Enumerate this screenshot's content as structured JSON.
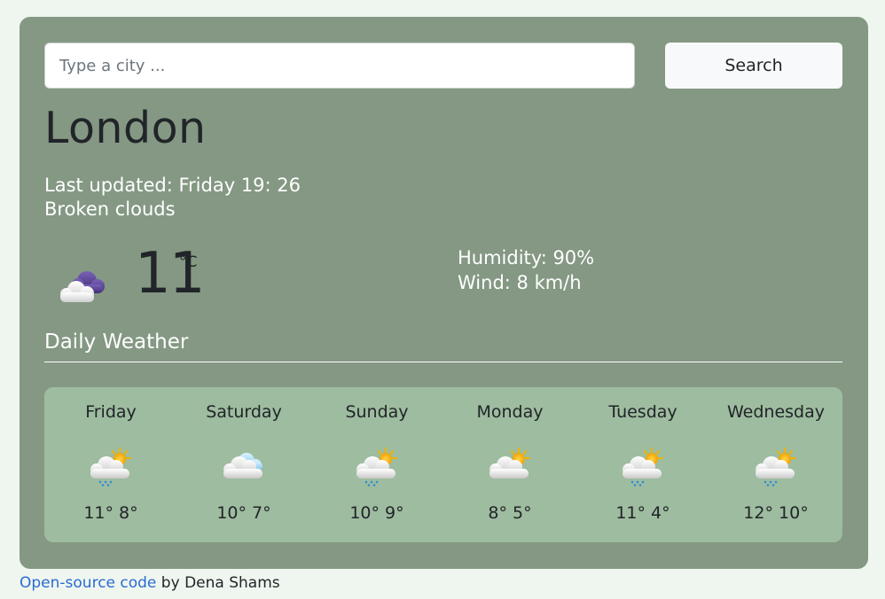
{
  "search": {
    "placeholder": "Type a city ...",
    "button_label": "Search"
  },
  "current": {
    "city": "London",
    "last_updated": "Last updated: Friday 19: 26",
    "description": "Broken clouds",
    "icon": "broken-clouds-icon",
    "temperature": "11",
    "unit": "°C",
    "humidity": "Humidity: 90%",
    "wind": "Wind: 8 km/h"
  },
  "daily": {
    "title": "Daily Weather",
    "days": [
      {
        "name": "Friday",
        "icon": "sun-cloud-rain-icon",
        "temps": "11° 8°"
      },
      {
        "name": "Saturday",
        "icon": "cloud-icon",
        "temps": "10° 7°"
      },
      {
        "name": "Sunday",
        "icon": "sun-cloud-rain-icon",
        "temps": "10° 9°"
      },
      {
        "name": "Monday",
        "icon": "sun-cloud-icon",
        "temps": "8° 5°"
      },
      {
        "name": "Tuesday",
        "icon": "sun-cloud-rain-icon",
        "temps": "11° 4°"
      },
      {
        "name": "Wednesday",
        "icon": "sun-cloud-rain-icon",
        "temps": "12° 10°"
      }
    ]
  },
  "footer": {
    "link_text": "Open-source code",
    "suffix": " by Dena Shams"
  }
}
